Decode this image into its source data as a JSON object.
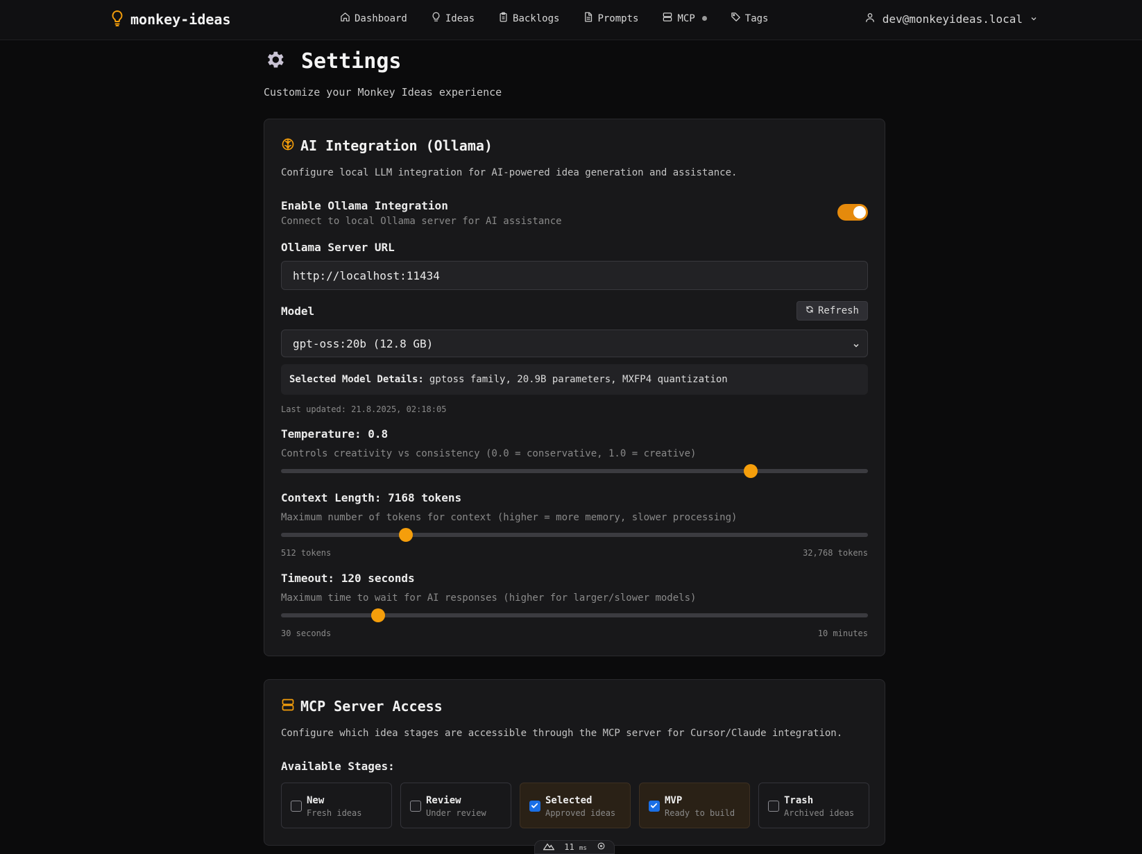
{
  "header": {
    "brand": "monkey-ideas",
    "nav": [
      {
        "label": "Dashboard",
        "icon": "home-icon"
      },
      {
        "label": "Ideas",
        "icon": "lightbulb-icon"
      },
      {
        "label": "Backlogs",
        "icon": "clipboard-icon"
      },
      {
        "label": "Prompts",
        "icon": "file-text-icon"
      },
      {
        "label": "MCP",
        "icon": "server-icon"
      },
      {
        "label": "Tags",
        "icon": "tag-icon"
      }
    ],
    "user_email": "dev@monkeyideas.local"
  },
  "page": {
    "title": "Settings",
    "subtitle": "Customize your Monkey Ideas experience"
  },
  "ai": {
    "title": "AI Integration (Ollama)",
    "description": "Configure local LLM integration for AI-powered idea generation and assistance.",
    "enable_label": "Enable Ollama Integration",
    "enable_hint": "Connect to local Ollama server for AI assistance",
    "enabled": true,
    "url_label": "Ollama Server URL",
    "url_value": "http://localhost:11434",
    "model_label": "Model",
    "refresh_label": "Refresh",
    "model_value": "gpt-oss:20b (12.8 GB)",
    "details_label": "Selected Model Details:",
    "details_value": "gptoss family, 20.9B parameters, MXFP4 quantization",
    "last_updated": "Last updated: 21.8.2025, 02:18:05",
    "temperature_label": "Temperature: 0.8",
    "temperature_hint": "Controls creativity vs consistency (0.0 = conservative, 1.0 = creative)",
    "temperature_fraction": 0.8,
    "context_label": "Context Length: 7168 tokens",
    "context_hint": "Maximum number of tokens for context (higher = more memory, slower processing)",
    "context_fraction": 0.213,
    "context_min": "512 tokens",
    "context_max": "32,768 tokens",
    "timeout_label": "Timeout: 120 seconds",
    "timeout_hint": "Maximum time to wait for AI responses (higher for larger/slower models)",
    "timeout_fraction": 0.165,
    "timeout_min": "30 seconds",
    "timeout_max": "10 minutes"
  },
  "mcp": {
    "title": "MCP Server Access",
    "description": "Configure which idea stages are accessible through the MCP server for Cursor/Claude integration.",
    "stages_label": "Available Stages:",
    "stages": [
      {
        "name": "New",
        "desc": "Fresh ideas",
        "checked": false
      },
      {
        "name": "Review",
        "desc": "Under review",
        "checked": false
      },
      {
        "name": "Selected",
        "desc": "Approved ideas",
        "checked": true
      },
      {
        "name": "MVP",
        "desc": "Ready to build",
        "checked": true
      },
      {
        "name": "Trash",
        "desc": "Archived ideas",
        "checked": false
      }
    ]
  },
  "perf": {
    "value": "11",
    "unit": "ms"
  },
  "colors": {
    "accent": "#f59e0b",
    "toggle": "#e58a0c",
    "checkbox": "#1a6fe6"
  }
}
